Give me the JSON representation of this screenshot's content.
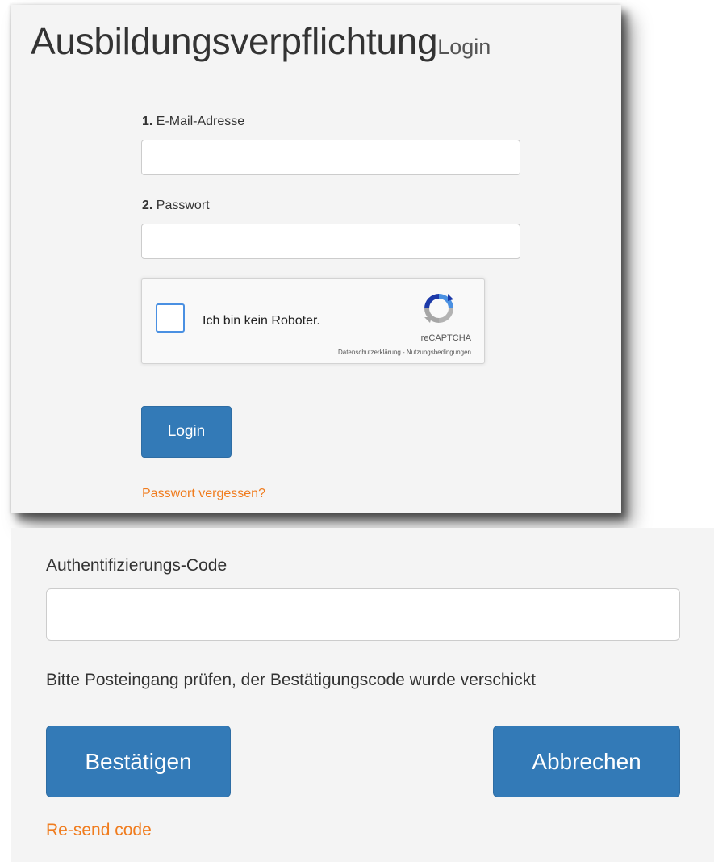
{
  "login": {
    "title": "Ausbildungsverpflichtung",
    "subtitle": "Login",
    "email_label_number": "1.",
    "email_label": "E-Mail-Adresse",
    "email_value": "",
    "password_label_number": "2.",
    "password_label": "Passwort",
    "password_value": "",
    "recaptcha": {
      "label": "Ich bin kein Roboter.",
      "brand": "reCAPTCHA",
      "privacy_link": "Datenschutzerklärung",
      "separator": " - ",
      "terms_link": "Nutzungsbedingungen"
    },
    "login_button": "Login",
    "forgot_link": "Passwort vergessen?"
  },
  "auth": {
    "label": "Authentifizierungs-Code",
    "code_value": "",
    "hint": "Bitte Posteingang prüfen, der Bestätigungscode wurde verschickt",
    "confirm_button": "Bestätigen",
    "cancel_button": "Abbrechen",
    "resend_link": "Re-send code"
  },
  "colors": {
    "primary": "#337ab7",
    "link": "#f07c1e",
    "panel_bg": "#f4f4f4",
    "checkbox_border": "#4a90e2"
  },
  "icons": {
    "recaptcha_logo": "recaptcha-logo-icon"
  }
}
